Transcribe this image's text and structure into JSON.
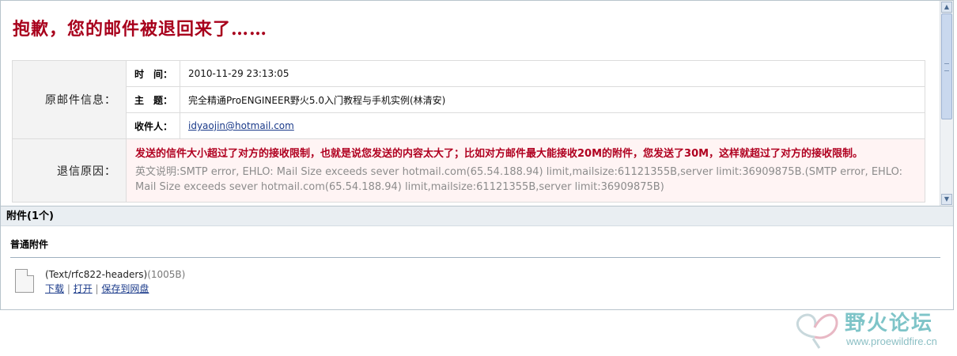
{
  "headline": "抱歉，您的邮件被退回来了……",
  "original": {
    "section_label": "原邮件信息：",
    "time_label": "时　间：",
    "time_value": "2010-11-29 23:13:05",
    "subject_label": "主　题：",
    "subject_value": "完全精通ProENGINEER野火5.0入门教程与手机实例(林清安)",
    "recipient_label": "收件人：",
    "recipient_value": "idyaojin@hotmail.com"
  },
  "bounce": {
    "section_label": "退信原因：",
    "main_reason": "发送的信件大小超过了对方的接收限制，也就是说您发送的内容太大了；比如对方邮件最大能接收20M的附件，您发送了30M，这样就超过了对方的接收限制。",
    "detail": "英文说明:SMTP error, EHLO: Mail Size exceeds sever hotmail.com(65.54.188.94) limit,mailsize:61121355B,server limit:36909875B.(SMTP error, EHLO: Mail Size exceeds sever hotmail.com(65.54.188.94) limit,mailsize:61121355B,server limit:36909875B)"
  },
  "attachments": {
    "header": "附件(1个)",
    "section": "普通附件",
    "file_name": "(Text/rfc822-headers)",
    "file_size": "(1005B)",
    "download_label": "下载",
    "open_label": "打开",
    "save_label": "保存到网盘"
  },
  "watermark": {
    "text": "野火论坛",
    "url": "www.proewildfire.cn"
  },
  "colors": {
    "headline": "#a8001c",
    "bounce_reason": "#b00020",
    "link": "#1a3a8a"
  }
}
